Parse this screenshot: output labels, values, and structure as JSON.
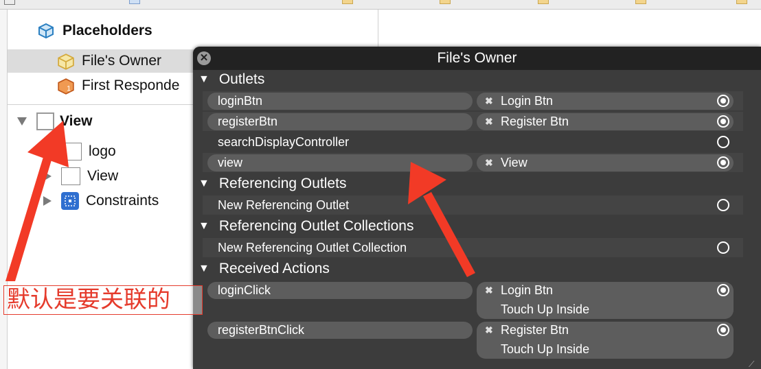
{
  "outline": {
    "placeholders_label": "Placeholders",
    "files_owner_label": "File's Owner",
    "first_responder_label": "First Responde",
    "view_label": "View",
    "logo_label": "logo",
    "subview_label": "View",
    "constraints_label": "Constraints"
  },
  "hud": {
    "title": "File's Owner",
    "close_glyph": "✕",
    "sections": {
      "outlets": "Outlets",
      "referencing_outlets": "Referencing Outlets",
      "referencing_outlet_collections": "Referencing Outlet Collections",
      "received_actions": "Received Actions"
    },
    "outlets": [
      {
        "name": "loginBtn",
        "target": "Login Btn",
        "connected": true
      },
      {
        "name": "registerBtn",
        "target": "Register Btn",
        "connected": true
      },
      {
        "name": "searchDisplayController",
        "target": "",
        "connected": false
      },
      {
        "name": "view",
        "target": "View",
        "connected": true
      }
    ],
    "referencing_outlets": [
      {
        "name": "New Referencing Outlet",
        "connected": false
      }
    ],
    "referencing_outlet_collections": [
      {
        "name": "New Referencing Outlet Collection",
        "connected": false
      }
    ],
    "received_actions": [
      {
        "name": "loginClick",
        "target": "Login Btn",
        "event": "Touch Up Inside",
        "connected": true
      },
      {
        "name": "registerBtnClick",
        "target": "Register Btn",
        "event": "Touch Up Inside",
        "connected": true
      }
    ],
    "disconnect_glyph": "✖",
    "disclosure_glyph": "▼"
  },
  "annotation": {
    "note": "默认是要关联的",
    "color": "#e53b2c"
  }
}
